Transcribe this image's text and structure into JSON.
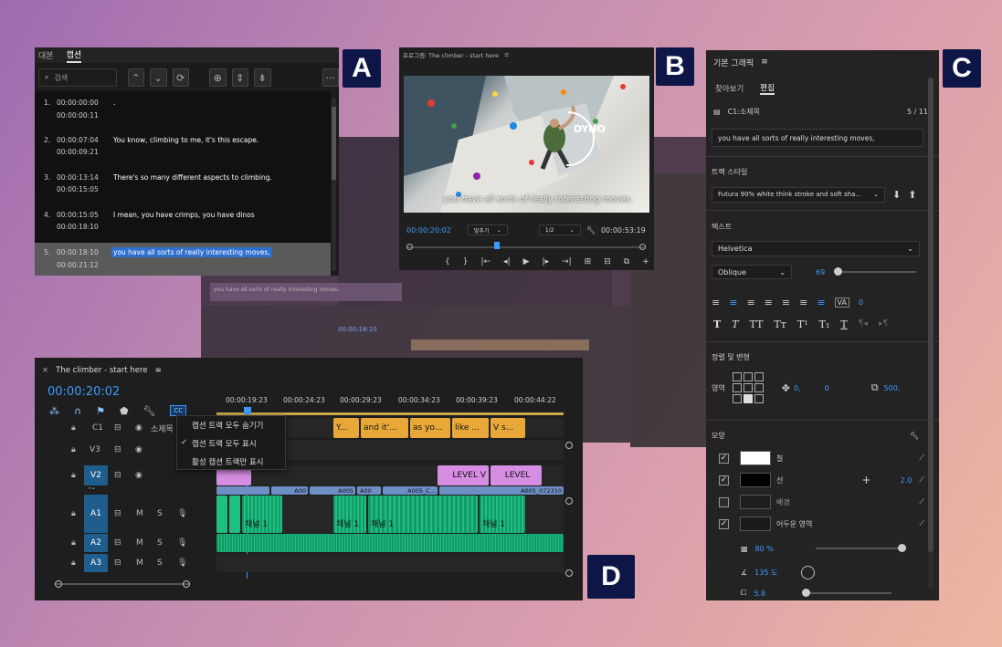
{
  "panelA": {
    "tabs": [
      "대본",
      "캡션"
    ],
    "search_placeholder": "검색",
    "captions": [
      {
        "num": "1.",
        "in": "00:00:00:00",
        "out": "00:00:00:11",
        "text": "."
      },
      {
        "num": "2.",
        "in": "00:00:07:04",
        "out": "00:00:09:21",
        "text": "You know, climbing to me, it's this escape."
      },
      {
        "num": "3.",
        "in": "00:00:13:14",
        "out": "00:00:15:05",
        "text": "There's so many different aspects to climbing."
      },
      {
        "num": "4.",
        "in": "00:00:15:05",
        "out": "00:00:18:10",
        "text": "I mean, you have crimps, you have dinos"
      },
      {
        "num": "5.",
        "in": "00:00:18:10",
        "out": "00:00:21:12",
        "text": "you have all sorts of really interesting moves,"
      }
    ]
  },
  "panelB": {
    "title": "프로그램: The climber - start here",
    "overlay_text": "you have all sorts of really interesting moves,",
    "dyno": "DYNO",
    "timecode": "00:00:20:02",
    "fit": "맞추기",
    "quality": "1/2",
    "duration": "00:00:53:19"
  },
  "panelC": {
    "title": "기본 그래픽",
    "tabs": [
      "찾아보기",
      "편집"
    ],
    "layer": "C1:소제목",
    "layer_count": "5 / 11",
    "text_value": "you have all sorts of really interesting moves,",
    "track_style_label": "트랙 스타일",
    "track_style": "Futura 90% white think stroke and soft sha...",
    "text_label": "텍스트",
    "font": "Helvetica",
    "font_style": "Oblique",
    "font_size": "69",
    "tracking": "0",
    "align_label": "정렬 및 변형",
    "area_label": "영역",
    "pos_x": "0,",
    "pos_y": "0",
    "scale": "500,",
    "appearance_label": "모양",
    "appearance": [
      {
        "label": "칠",
        "checked": true,
        "color": "#ffffff"
      },
      {
        "label": "선",
        "checked": true,
        "color": "#000000",
        "value": "2.0"
      },
      {
        "label": "배경",
        "checked": false,
        "color": "#1e1e1e"
      },
      {
        "label": "어두운 영역",
        "checked": true,
        "color": "#1a1a1a"
      }
    ],
    "opacity": "80 %",
    "angle": "135 도",
    "distance": "5.8"
  },
  "panelD": {
    "title": "The climber - start here",
    "timecode": "00:00:20:02",
    "ruler": [
      "00:00:19:23",
      "00:00:24:23",
      "00:00:29:23",
      "00:00:34:23",
      "00:00:39:23",
      "00:00:44:22"
    ],
    "menu": [
      {
        "label": "캡션 트랙 모두 숨기기",
        "checked": false
      },
      {
        "label": "캡션 트랙 모두 표시",
        "checked": true
      },
      {
        "label": "활성 캡션 트랙만 표시",
        "checked": false
      }
    ],
    "tracks": [
      "C1",
      "V3",
      "V2",
      "V1",
      "A1",
      "A2",
      "A3"
    ],
    "c1_name": "소제목",
    "caption_clips": [
      "Y...",
      "and it'...",
      "as yo...",
      "like ...",
      "V s..."
    ],
    "v2_clips": [
      "LEVEL V",
      "LEVEL"
    ],
    "v1_clips": [
      "A00",
      "A005",
      "A00",
      "A005_C...",
      "A005_072310"
    ],
    "a1_label": "채널 1"
  },
  "callouts": [
    "A",
    "B",
    "C",
    "D"
  ],
  "bg_ghost": {
    "caption": "you have all sorts of really interesting moves,",
    "timecode": "00:00:18:10"
  },
  "colors": {
    "accent": "#3d9bff",
    "caption_clip": "#e8a838",
    "video_clip": "#d68ee2",
    "audio_clip": "#1fbf82",
    "callout_bg": "#0e1648"
  }
}
